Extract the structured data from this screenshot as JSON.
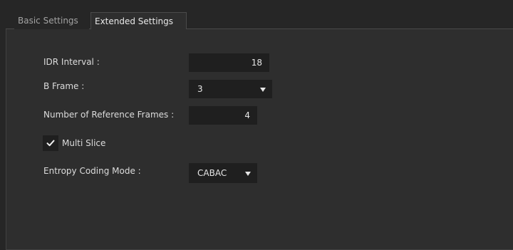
{
  "tabs": {
    "basic": "Basic Settings",
    "extended": "Extended Settings",
    "active": "extended"
  },
  "form": {
    "idr_interval": {
      "label": "IDR Interval :",
      "value": "18"
    },
    "b_frame": {
      "label": "B Frame :",
      "value": "3"
    },
    "reference_frames": {
      "label": "Number of Reference Frames :",
      "value": "4"
    },
    "multi_slice": {
      "label": "Multi Slice",
      "checked": true
    },
    "entropy_coding": {
      "label": "Entropy Coding Mode :",
      "value": "CABAC"
    }
  },
  "icons": {
    "check": "checkmark-icon",
    "dropdown": "chevron-down-icon"
  },
  "colors": {
    "background": "#262626",
    "panel": "#2e2e2e",
    "field": "#1f1f1f",
    "text": "#dcdcdc"
  }
}
